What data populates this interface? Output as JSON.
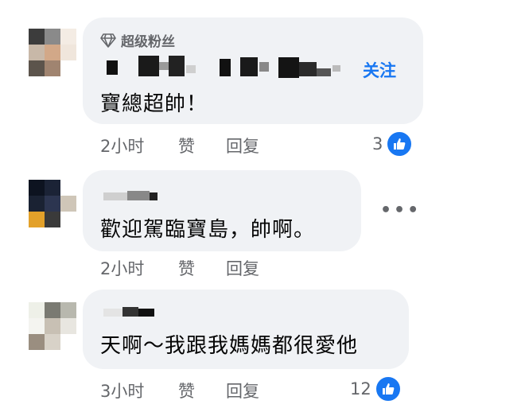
{
  "comments": [
    {
      "badge": "超级粉丝",
      "follow_label": "关注",
      "text": "寶總超帥！",
      "time": "2小时",
      "like_label": "赞",
      "reply_label": "回复",
      "like_count": "3",
      "avatar_colors": [
        "#3c3c3c",
        "#8a8a8a",
        "#e0d8d0",
        "#a89888",
        "#caa78a",
        "#d8d0c8",
        "#6e6258",
        "#ecdcd0",
        "#ffffff"
      ]
    },
    {
      "text": "歡迎駕臨寶島，帥啊。",
      "time": "2小时",
      "like_label": "赞",
      "reply_label": "回复",
      "more_label": "•••",
      "avatar_colors": [
        "#0d1320",
        "#1d2438",
        "#6a6f7e",
        "#1a2233",
        "#2c3550",
        "#cfc6b8",
        "#e3a12a",
        "#3a3a3a",
        "#ffffff"
      ]
    },
    {
      "text": "天啊～我跟我媽媽都很愛他",
      "time": "3小时",
      "like_label": "赞",
      "reply_label": "回复",
      "like_count": "12",
      "avatar_colors": [
        "#eef0e8",
        "#7a7a72",
        "#b8b8ae",
        "#f4f4f0",
        "#c8c0b4",
        "#e8e6e0",
        "#9a8e80",
        "#d8d2c8",
        "#ffffff"
      ]
    }
  ],
  "colors": {
    "accent": "#1877f2",
    "bubble": "#f0f2f5",
    "muted": "#65676b"
  }
}
